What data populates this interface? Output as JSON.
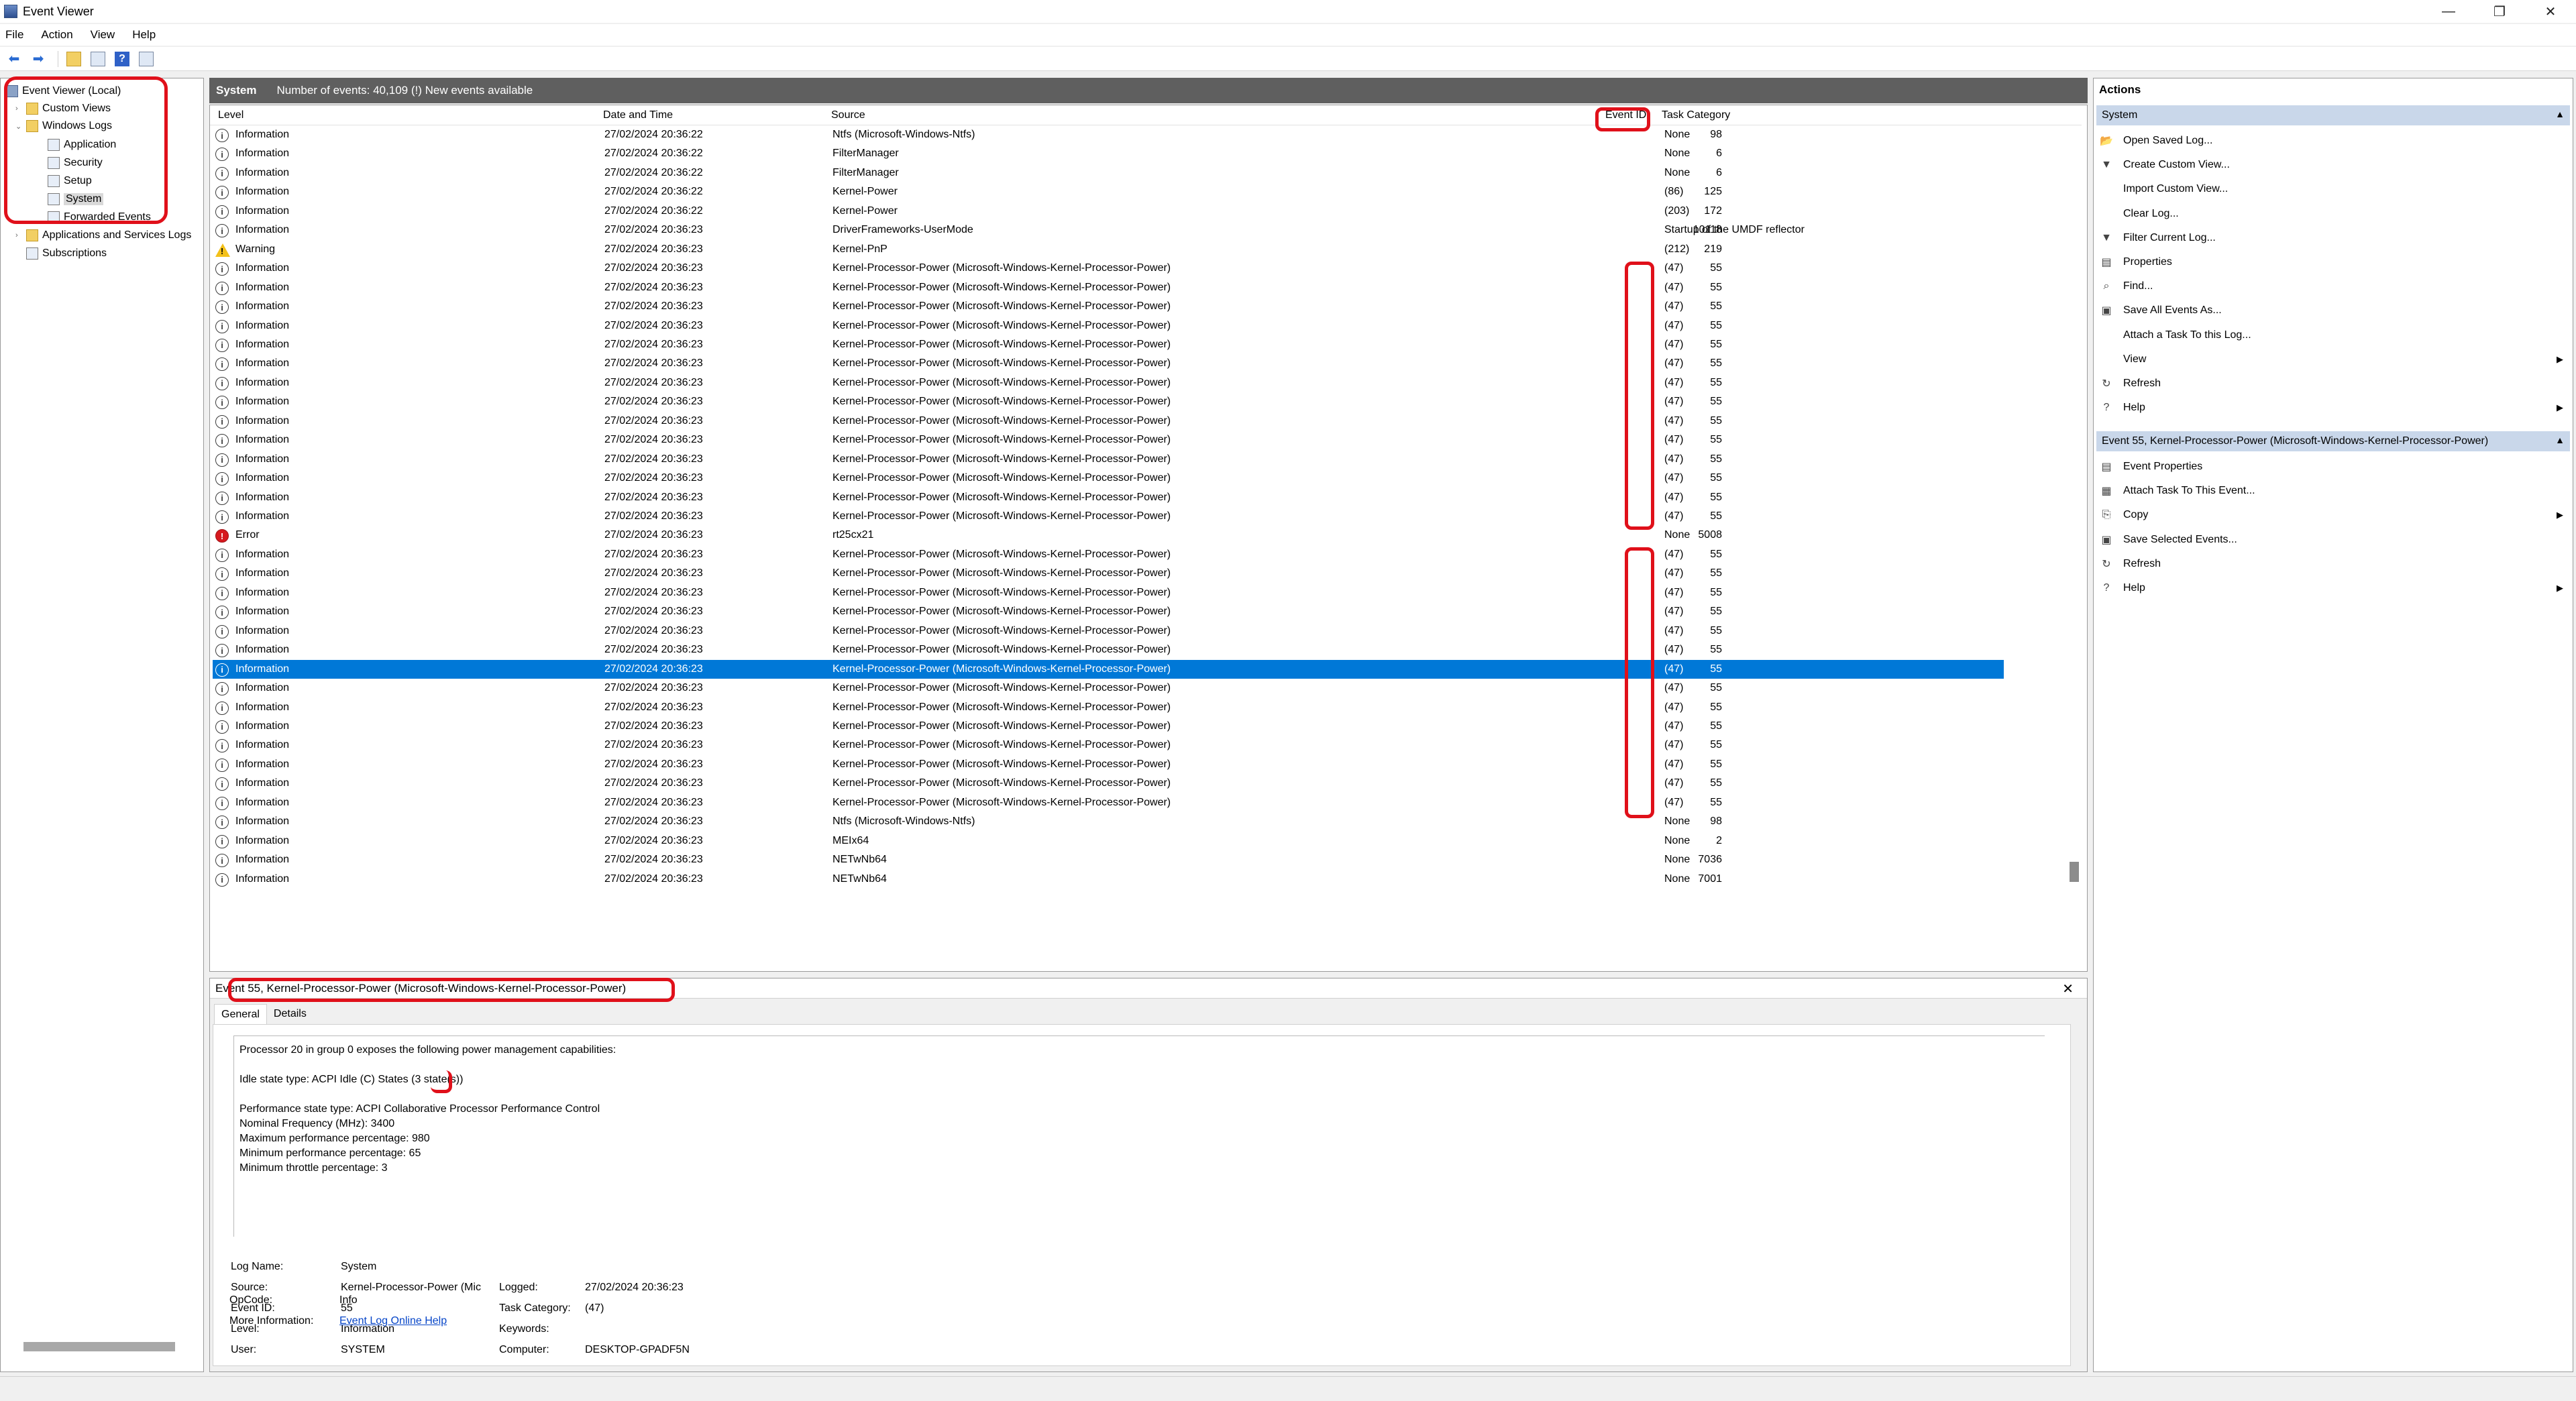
{
  "window": {
    "title": "Event Viewer",
    "minimize": "—",
    "restore": "❐",
    "close": "✕"
  },
  "menu": [
    "File",
    "Action",
    "View",
    "Help"
  ],
  "toolbar": {
    "back": "⬅",
    "forward": "➡",
    "help": "?"
  },
  "tree": {
    "root": "Event Viewer (Local)",
    "custom_views": "Custom Views",
    "windows_logs": "Windows Logs",
    "application": "Application",
    "security": "Security",
    "setup": "Setup",
    "system": "System",
    "forwarded": "Forwarded Events",
    "apps_services": "Applications and Services Logs",
    "subscriptions": "Subscriptions"
  },
  "center": {
    "log_name": "System",
    "summary": "Number of events: 40,109 (!) New events available"
  },
  "columns": {
    "level": "Level",
    "date": "Date and Time",
    "source": "Source",
    "event_id": "Event ID",
    "category": "Task Category"
  },
  "events": [
    {
      "level": "Information",
      "date": "27/02/2024 20:36:22",
      "source": "Ntfs (Microsoft-Windows-Ntfs)",
      "id": "98",
      "category": "None"
    },
    {
      "level": "Information",
      "date": "27/02/2024 20:36:22",
      "source": "FilterManager",
      "id": "6",
      "category": "None"
    },
    {
      "level": "Information",
      "date": "27/02/2024 20:36:22",
      "source": "FilterManager",
      "id": "6",
      "category": "None"
    },
    {
      "level": "Information",
      "date": "27/02/2024 20:36:22",
      "source": "Kernel-Power",
      "id": "125",
      "category": "(86)"
    },
    {
      "level": "Information",
      "date": "27/02/2024 20:36:22",
      "source": "Kernel-Power",
      "id": "172",
      "category": "(203)"
    },
    {
      "level": "Information",
      "date": "27/02/2024 20:36:23",
      "source": "DriverFrameworks-UserMode",
      "id": "10118",
      "category": "Startup of the UMDF reflector"
    },
    {
      "level": "Warning",
      "date": "27/02/2024 20:36:23",
      "source": "Kernel-PnP",
      "id": "219",
      "category": "(212)"
    },
    {
      "level": "Information",
      "date": "27/02/2024 20:36:23",
      "source": "Kernel-Processor-Power (Microsoft-Windows-Kernel-Processor-Power)",
      "id": "55",
      "category": "(47)"
    },
    {
      "level": "Information",
      "date": "27/02/2024 20:36:23",
      "source": "Kernel-Processor-Power (Microsoft-Windows-Kernel-Processor-Power)",
      "id": "55",
      "category": "(47)"
    },
    {
      "level": "Information",
      "date": "27/02/2024 20:36:23",
      "source": "Kernel-Processor-Power (Microsoft-Windows-Kernel-Processor-Power)",
      "id": "55",
      "category": "(47)"
    },
    {
      "level": "Information",
      "date": "27/02/2024 20:36:23",
      "source": "Kernel-Processor-Power (Microsoft-Windows-Kernel-Processor-Power)",
      "id": "55",
      "category": "(47)"
    },
    {
      "level": "Information",
      "date": "27/02/2024 20:36:23",
      "source": "Kernel-Processor-Power (Microsoft-Windows-Kernel-Processor-Power)",
      "id": "55",
      "category": "(47)"
    },
    {
      "level": "Information",
      "date": "27/02/2024 20:36:23",
      "source": "Kernel-Processor-Power (Microsoft-Windows-Kernel-Processor-Power)",
      "id": "55",
      "category": "(47)"
    },
    {
      "level": "Information",
      "date": "27/02/2024 20:36:23",
      "source": "Kernel-Processor-Power (Microsoft-Windows-Kernel-Processor-Power)",
      "id": "55",
      "category": "(47)"
    },
    {
      "level": "Information",
      "date": "27/02/2024 20:36:23",
      "source": "Kernel-Processor-Power (Microsoft-Windows-Kernel-Processor-Power)",
      "id": "55",
      "category": "(47)"
    },
    {
      "level": "Information",
      "date": "27/02/2024 20:36:23",
      "source": "Kernel-Processor-Power (Microsoft-Windows-Kernel-Processor-Power)",
      "id": "55",
      "category": "(47)"
    },
    {
      "level": "Information",
      "date": "27/02/2024 20:36:23",
      "source": "Kernel-Processor-Power (Microsoft-Windows-Kernel-Processor-Power)",
      "id": "55",
      "category": "(47)"
    },
    {
      "level": "Information",
      "date": "27/02/2024 20:36:23",
      "source": "Kernel-Processor-Power (Microsoft-Windows-Kernel-Processor-Power)",
      "id": "55",
      "category": "(47)"
    },
    {
      "level": "Information",
      "date": "27/02/2024 20:36:23",
      "source": "Kernel-Processor-Power (Microsoft-Windows-Kernel-Processor-Power)",
      "id": "55",
      "category": "(47)"
    },
    {
      "level": "Information",
      "date": "27/02/2024 20:36:23",
      "source": "Kernel-Processor-Power (Microsoft-Windows-Kernel-Processor-Power)",
      "id": "55",
      "category": "(47)"
    },
    {
      "level": "Information",
      "date": "27/02/2024 20:36:23",
      "source": "Kernel-Processor-Power (Microsoft-Windows-Kernel-Processor-Power)",
      "id": "55",
      "category": "(47)"
    },
    {
      "level": "Error",
      "date": "27/02/2024 20:36:23",
      "source": "rt25cx21",
      "id": "5008",
      "category": "None"
    },
    {
      "level": "Information",
      "date": "27/02/2024 20:36:23",
      "source": "Kernel-Processor-Power (Microsoft-Windows-Kernel-Processor-Power)",
      "id": "55",
      "category": "(47)"
    },
    {
      "level": "Information",
      "date": "27/02/2024 20:36:23",
      "source": "Kernel-Processor-Power (Microsoft-Windows-Kernel-Processor-Power)",
      "id": "55",
      "category": "(47)"
    },
    {
      "level": "Information",
      "date": "27/02/2024 20:36:23",
      "source": "Kernel-Processor-Power (Microsoft-Windows-Kernel-Processor-Power)",
      "id": "55",
      "category": "(47)"
    },
    {
      "level": "Information",
      "date": "27/02/2024 20:36:23",
      "source": "Kernel-Processor-Power (Microsoft-Windows-Kernel-Processor-Power)",
      "id": "55",
      "category": "(47)"
    },
    {
      "level": "Information",
      "date": "27/02/2024 20:36:23",
      "source": "Kernel-Processor-Power (Microsoft-Windows-Kernel-Processor-Power)",
      "id": "55",
      "category": "(47)"
    },
    {
      "level": "Information",
      "date": "27/02/2024 20:36:23",
      "source": "Kernel-Processor-Power (Microsoft-Windows-Kernel-Processor-Power)",
      "id": "55",
      "category": "(47)"
    },
    {
      "level": "Information",
      "date": "27/02/2024 20:36:23",
      "source": "Kernel-Processor-Power (Microsoft-Windows-Kernel-Processor-Power)",
      "id": "55",
      "category": "(47)",
      "selected": true
    },
    {
      "level": "Information",
      "date": "27/02/2024 20:36:23",
      "source": "Kernel-Processor-Power (Microsoft-Windows-Kernel-Processor-Power)",
      "id": "55",
      "category": "(47)"
    },
    {
      "level": "Information",
      "date": "27/02/2024 20:36:23",
      "source": "Kernel-Processor-Power (Microsoft-Windows-Kernel-Processor-Power)",
      "id": "55",
      "category": "(47)"
    },
    {
      "level": "Information",
      "date": "27/02/2024 20:36:23",
      "source": "Kernel-Processor-Power (Microsoft-Windows-Kernel-Processor-Power)",
      "id": "55",
      "category": "(47)"
    },
    {
      "level": "Information",
      "date": "27/02/2024 20:36:23",
      "source": "Kernel-Processor-Power (Microsoft-Windows-Kernel-Processor-Power)",
      "id": "55",
      "category": "(47)"
    },
    {
      "level": "Information",
      "date": "27/02/2024 20:36:23",
      "source": "Kernel-Processor-Power (Microsoft-Windows-Kernel-Processor-Power)",
      "id": "55",
      "category": "(47)"
    },
    {
      "level": "Information",
      "date": "27/02/2024 20:36:23",
      "source": "Kernel-Processor-Power (Microsoft-Windows-Kernel-Processor-Power)",
      "id": "55",
      "category": "(47)"
    },
    {
      "level": "Information",
      "date": "27/02/2024 20:36:23",
      "source": "Kernel-Processor-Power (Microsoft-Windows-Kernel-Processor-Power)",
      "id": "55",
      "category": "(47)"
    },
    {
      "level": "Information",
      "date": "27/02/2024 20:36:23",
      "source": "Ntfs (Microsoft-Windows-Ntfs)",
      "id": "98",
      "category": "None"
    },
    {
      "level": "Information",
      "date": "27/02/2024 20:36:23",
      "source": "MEIx64",
      "id": "2",
      "category": "None"
    },
    {
      "level": "Information",
      "date": "27/02/2024 20:36:23",
      "source": "NETwNb64",
      "id": "7036",
      "category": "None"
    },
    {
      "level": "Information",
      "date": "27/02/2024 20:36:23",
      "source": "NETwNb64",
      "id": "7001",
      "category": "None"
    }
  ],
  "detail": {
    "header": "Event 55, Kernel-Processor-Power (Microsoft-Windows-Kernel-Processor-Power)",
    "close": "✕",
    "tab_general": "General",
    "tab_details": "Details",
    "message": [
      "Processor 20 in group 0 exposes the following power management capabilities:",
      "",
      "Idle state type: ACPI Idle (C) States (3 state(s))",
      "",
      "Performance state type: ACPI Collaborative Processor Performance Control",
      "Nominal Frequency (MHz): 3400",
      "Maximum performance percentage: 980",
      "Minimum performance percentage: 65",
      "Minimum throttle percentage: 3"
    ],
    "props": {
      "log_name_label": "Log Name:",
      "log_name": "System",
      "source_label": "Source:",
      "source": "Kernel-Processor-Power (Mic",
      "logged_label": "Logged:",
      "logged": "27/02/2024 20:36:23",
      "event_id_label": "Event ID:",
      "event_id": "55",
      "task_label": "Task Category:",
      "task": "(47)",
      "level_label": "Level:",
      "level": "Information",
      "keywords_label": "Keywords:",
      "user_label": "User:",
      "user": "SYSTEM",
      "computer_label": "Computer:",
      "computer": "DESKTOP-GPADF5N",
      "opcode_label": "OpCode:",
      "opcode": "Info",
      "more_label": "More Information:",
      "more_link": "Event Log Online Help"
    }
  },
  "actions": {
    "title": "Actions",
    "section1": "System",
    "items1": [
      {
        "label": "Open Saved Log...",
        "icon": "📂"
      },
      {
        "label": "Create Custom View...",
        "icon": "▼"
      },
      {
        "label": "Import Custom View...",
        "icon": ""
      },
      {
        "label": "Clear Log...",
        "icon": ""
      },
      {
        "label": "Filter Current Log...",
        "icon": "▼"
      },
      {
        "label": "Properties",
        "icon": "▤"
      },
      {
        "label": "Find...",
        "icon": "⌕"
      },
      {
        "label": "Save All Events As...",
        "icon": "▣"
      },
      {
        "label": "Attach a Task To this Log...",
        "icon": ""
      },
      {
        "label": "View",
        "icon": "",
        "submenu": true
      },
      {
        "label": "Refresh",
        "icon": "↻"
      },
      {
        "label": "Help",
        "icon": "?",
        "submenu": true
      }
    ],
    "section2": "Event 55, Kernel-Processor-Power (Microsoft-Windows-Kernel-Processor-Power)",
    "items2": [
      {
        "label": "Event Properties",
        "icon": "▤"
      },
      {
        "label": "Attach Task To This Event...",
        "icon": "▦"
      },
      {
        "label": "Copy",
        "icon": "⎘",
        "submenu": true
      },
      {
        "label": "Save Selected Events...",
        "icon": "▣"
      },
      {
        "label": "Refresh",
        "icon": "↻"
      },
      {
        "label": "Help",
        "icon": "?",
        "submenu": true
      }
    ]
  },
  "colors": {
    "selection": "#0078d7",
    "section_header": "#c9d7ea",
    "annotation": "#e0101a"
  }
}
